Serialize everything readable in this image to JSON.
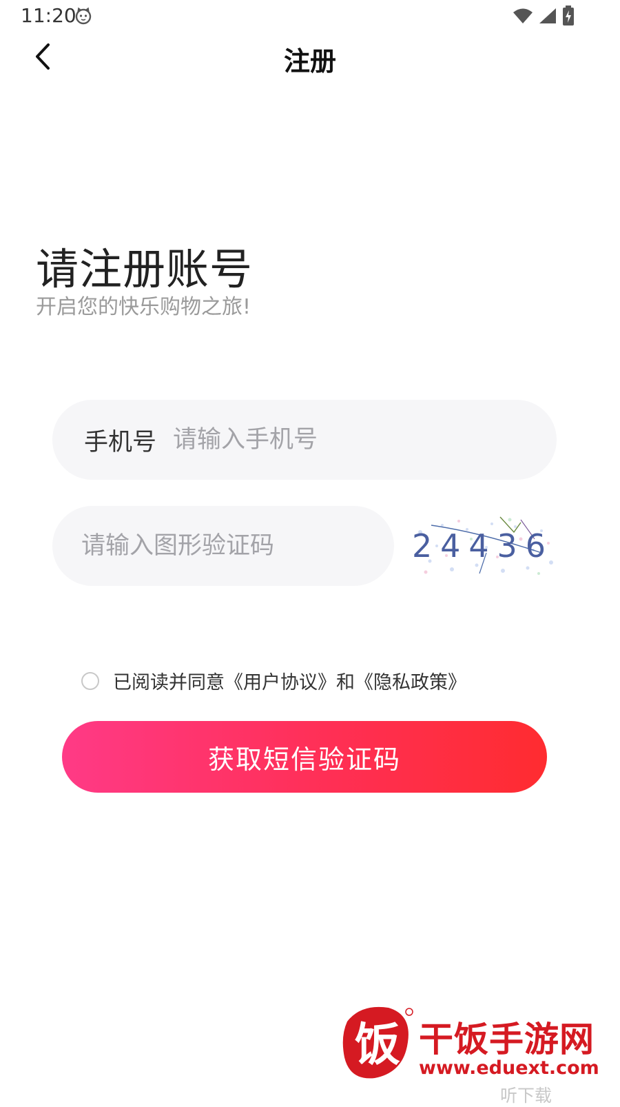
{
  "status_bar": {
    "time": "11:20"
  },
  "header": {
    "title": "注册"
  },
  "intro": {
    "heading": "请注册账号",
    "subheading": "开启您的快乐购物之旅!"
  },
  "form": {
    "phone_label": "手机号",
    "phone_placeholder": "请输入手机号",
    "captcha_placeholder": "请输入图形验证码",
    "captcha_code": "24436"
  },
  "agreement": {
    "prefix": "已阅读并同意",
    "user_agreement": "《用户协议》",
    "conjunction": "和",
    "privacy_policy": "《隐私政策》",
    "checked": false
  },
  "submit_label": "获取短信验证码",
  "watermark": {
    "logo_char": "饭",
    "site_name": "干饭手游网",
    "url": "www.eduext.com",
    "download_text": "听下载"
  },
  "colors": {
    "button_gradient_start": "#ff3a86",
    "button_gradient_end": "#ff2c30",
    "watermark_red": "#d51a22",
    "input_bg": "#f6f6f8"
  },
  "icons": [
    "cat-face-icon",
    "wifi-icon",
    "signal-icon",
    "battery-charging-icon",
    "back-arrow-icon"
  ]
}
